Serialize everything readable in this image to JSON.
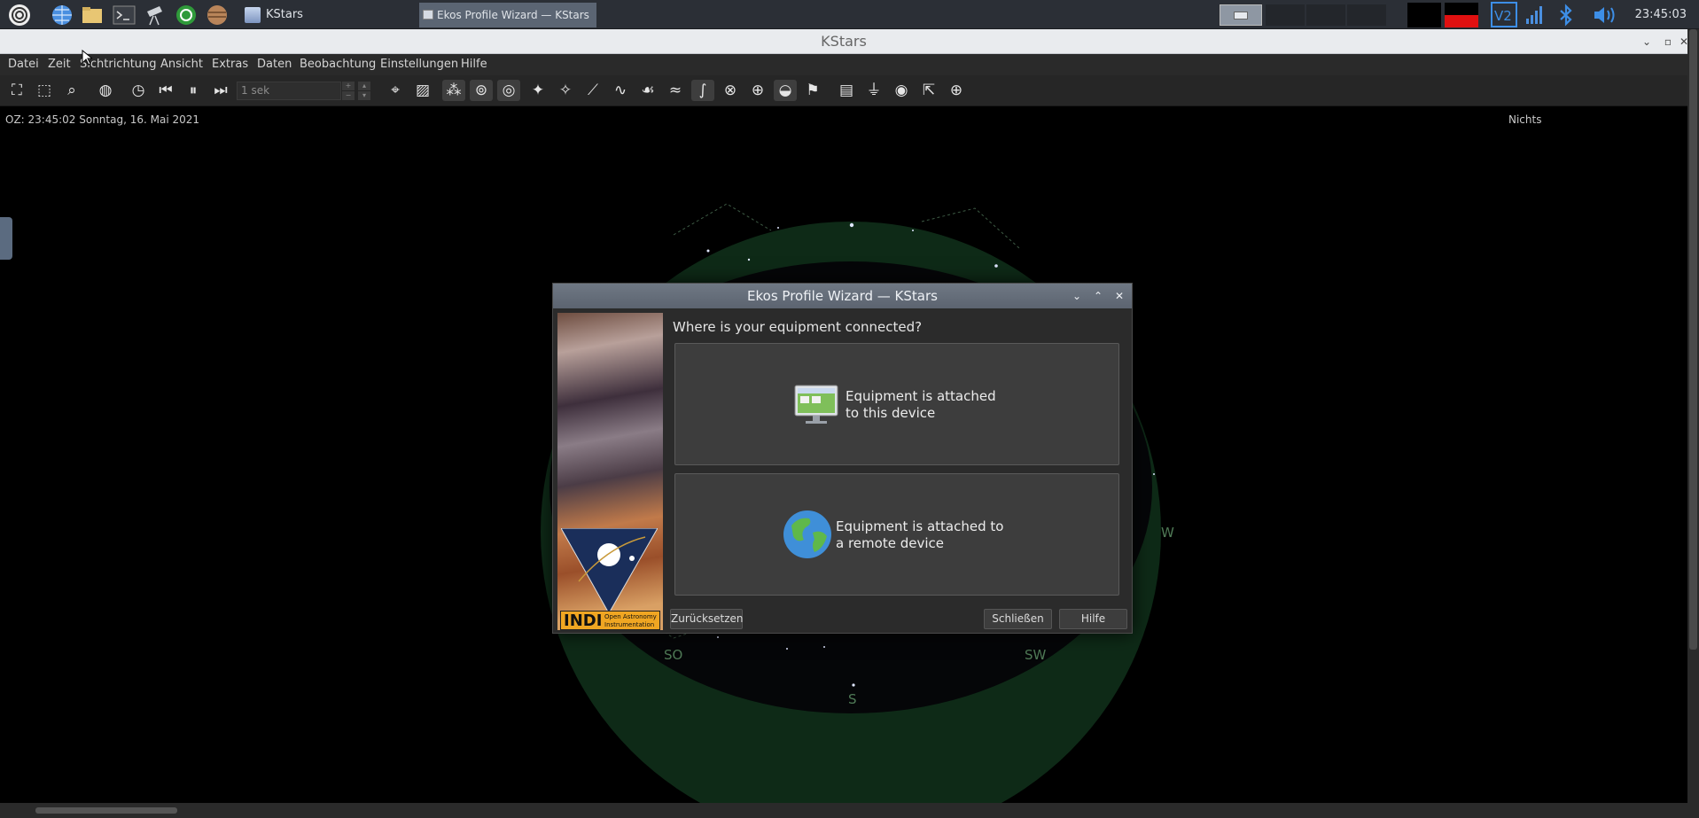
{
  "taskbar": {
    "launcher_icons": [
      "raspberry-menu-icon",
      "browser-icon",
      "file-manager-icon",
      "terminal-icon",
      "telescope-icon",
      "indi-icon",
      "planet-icon"
    ],
    "tasks": [
      {
        "label": "KStars",
        "active": false
      },
      {
        "label": "Ekos Profile Wizard — KStars",
        "active": true
      }
    ],
    "tray_icons": [
      "vnc-icon",
      "network-signal-icon",
      "bluetooth-icon",
      "volume-icon"
    ],
    "clock": "23:45:03"
  },
  "window": {
    "title": "KStars"
  },
  "menubar": {
    "items": [
      "Datei",
      "Zeit",
      "Sichtrichtung",
      "Ansicht",
      "Extras",
      "Daten",
      "Beobachtung",
      "Einstellungen",
      "Hilfe"
    ]
  },
  "toolbar": {
    "time_step_value": "1 sek"
  },
  "status": {
    "left": "OZ: 23:45:02   Sonntag, 16. Mai 2021",
    "right": "Nichts"
  },
  "sky": {
    "compass_labels": {
      "west": "W",
      "southeast": "SO",
      "southwest": "SW",
      "south": "S"
    }
  },
  "dialog": {
    "title": "Ekos Profile Wizard — KStars",
    "question": "Where is your equipment connected?",
    "choice_local": "Equipment is attached\nto this device",
    "choice_remote": "Equipment is attached to\na remote device",
    "reset_button": "Zurücksetzen",
    "close_button": "Schließen",
    "help_button": "Hilfe",
    "logo_text": "INDI",
    "logo_subtext": "Open Astronomy Instrumentation"
  },
  "colors": {
    "taskbar_bg": "#2b2f36",
    "dialog_title_bg": "#636b77",
    "horizon_green": "#0e2a17",
    "compass_green": "#4f7a56"
  }
}
